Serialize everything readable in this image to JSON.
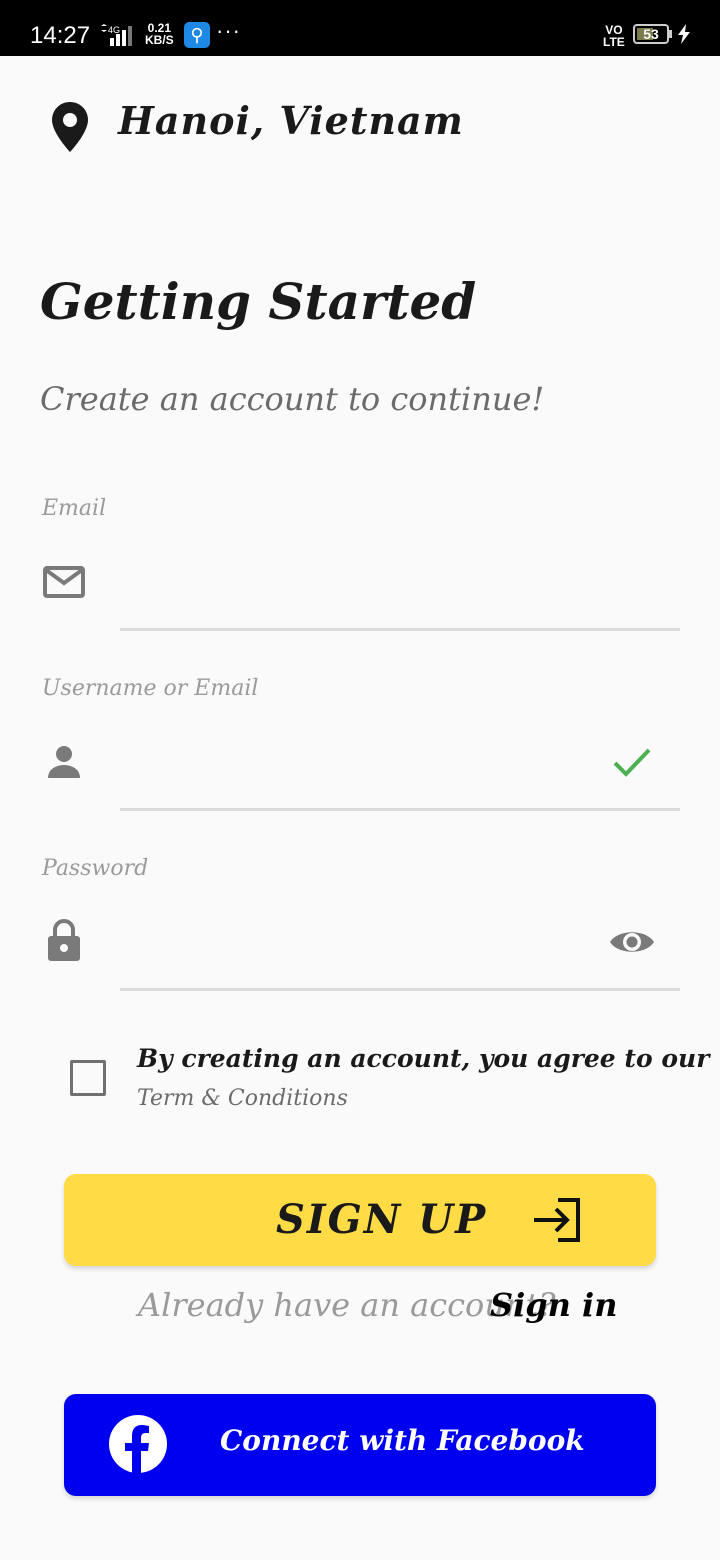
{
  "status_bar": {
    "time": "14:27",
    "network": "4G",
    "speed_value": "0.21",
    "speed_unit": "KB/S",
    "volte_top": "VO",
    "volte_bottom": "LTE",
    "battery": "53"
  },
  "header": {
    "location": "Hanoi,  Vietnam",
    "location_icon": "map-pin-icon"
  },
  "main": {
    "title": "Getting Started",
    "subtitle": "Create an account to continue!"
  },
  "form": {
    "email": {
      "label": "Email",
      "value": "",
      "icon": "mail-icon"
    },
    "username": {
      "label": "Username or Email",
      "value": "",
      "icon": "person-icon",
      "status_icon": "check-icon",
      "status_color": "#4caf50"
    },
    "password": {
      "label": "Password",
      "value": "",
      "icon": "lock-icon",
      "toggle_icon": "eye-icon"
    },
    "agreement": {
      "checked": false,
      "text": "By creating an account,  you agree to our",
      "terms_link": "Term & Conditions"
    }
  },
  "actions": {
    "signup_label": "SIGN UP",
    "signup_color": "#ffdb46",
    "already_text": "Already have an account?",
    "signin_link": "Sign in",
    "facebook_label": "Connect with Facebook",
    "facebook_color": "#0000f0"
  }
}
